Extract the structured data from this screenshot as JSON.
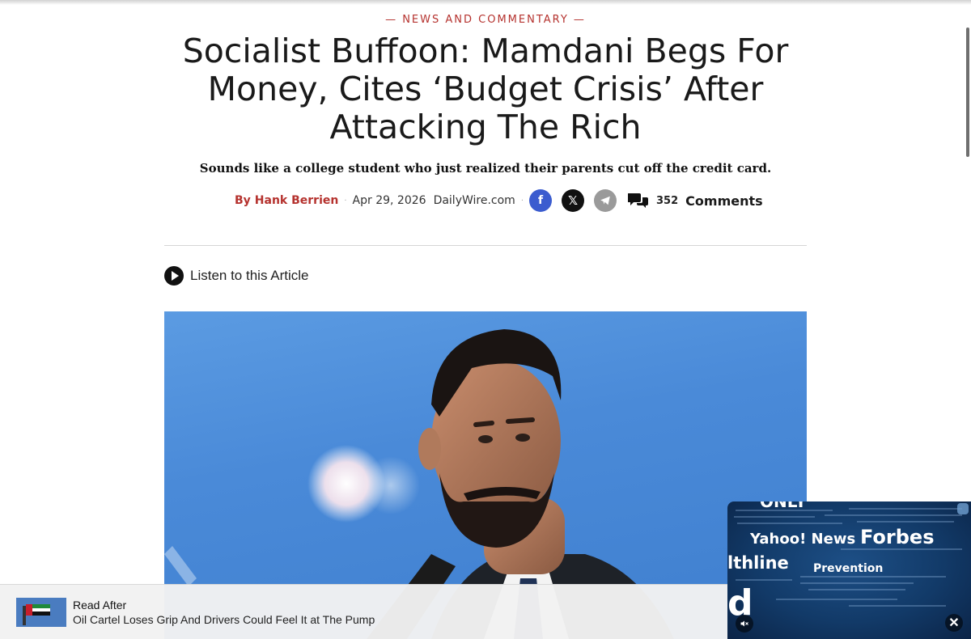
{
  "article": {
    "kicker": "— NEWS AND COMMENTARY —",
    "headline": "Socialist Buffoon: Mamdani Begs For Money, Cites ‘Budget Crisis’ After Attacking The Rich",
    "dek": "Sounds like a college student who just realized their parents cut off the credit card.",
    "byline": {
      "by": "By",
      "author": "Hank Berrien",
      "separator": "·",
      "date": "Apr 29, 2026",
      "site": "DailyWire.com"
    },
    "share": [
      {
        "name": "facebook",
        "icon": "facebook-icon",
        "glyph": "f"
      },
      {
        "name": "x",
        "icon": "x-icon",
        "glyph": "𝕏"
      },
      {
        "name": "telegram",
        "icon": "telegram-icon"
      }
    ],
    "comments": {
      "count": "352",
      "label": "Comments",
      "icon": "comments-icon"
    },
    "listen_label": "Listen to this Article"
  },
  "read_after": {
    "kicker": "Read After",
    "title": "Oil Cartel Loses Grip And Drivers Could Feel It at The Pump"
  },
  "video": {
    "overlay_words": {
      "only": "ONLY",
      "yahoo": "Yahoo! News",
      "forbes": "Forbes",
      "health": "lthline",
      "prevention": "Prevention",
      "d": "d"
    },
    "close_glyph": "✕"
  },
  "colors": {
    "accent": "#b5322e",
    "facebook": "#3b5ccf",
    "x": "#111111",
    "telegram": "#9a9a9a"
  }
}
